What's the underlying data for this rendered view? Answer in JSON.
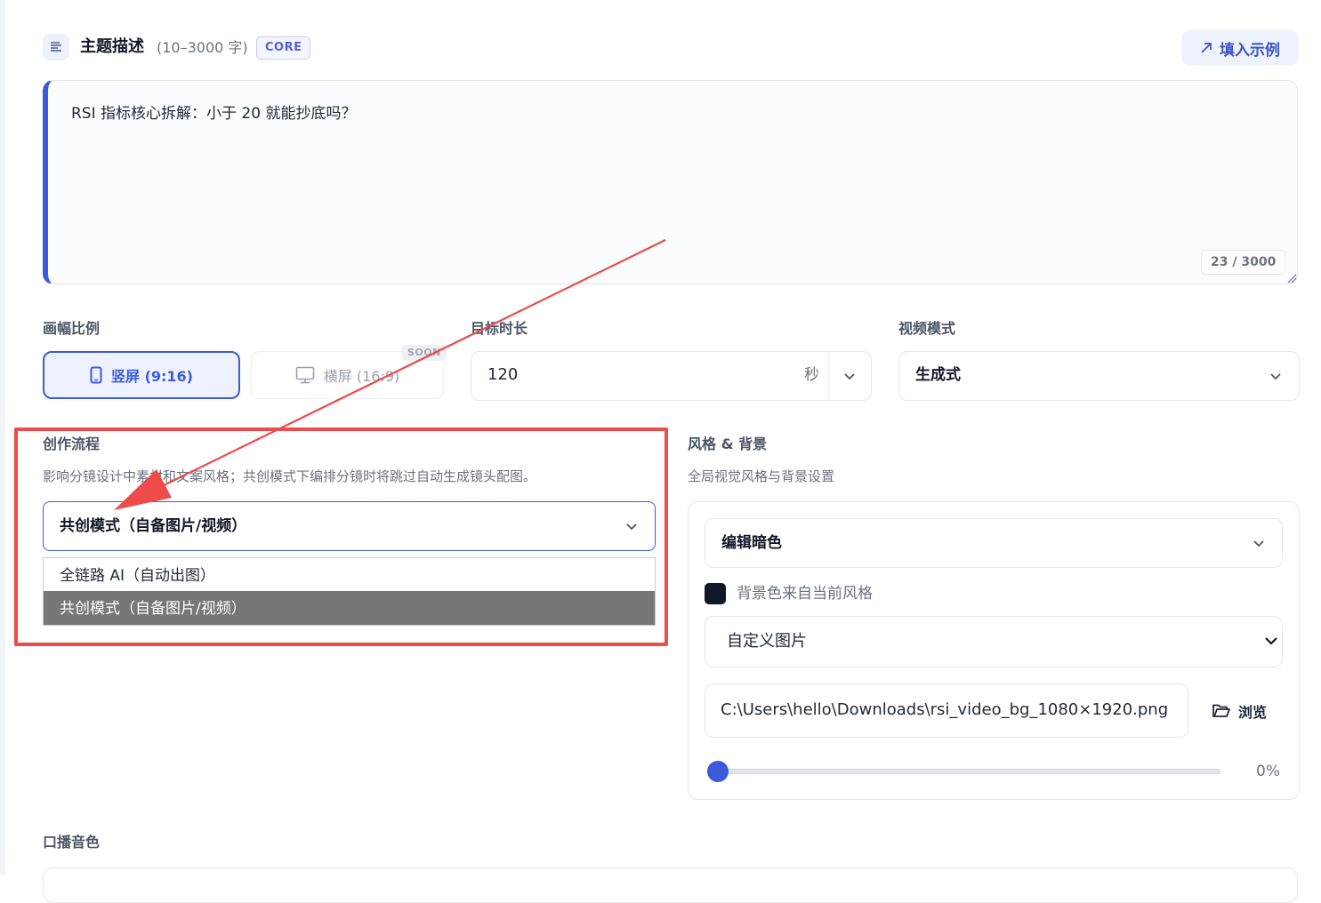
{
  "topic": {
    "title": "主题描述",
    "range": "(10–3000 字)",
    "badge": "CORE",
    "fill_example_label": "填入示例",
    "text": "RSI 指标核心拆解：小于 20 就能抄底吗？",
    "counter": "23 / 3000"
  },
  "ratio": {
    "label": "画幅比例",
    "portrait_label": "竖屏 (9:16)",
    "landscape_label": "横屏 (16:9)",
    "soon_badge": "SOON"
  },
  "duration": {
    "label": "目标时长",
    "value": "120",
    "unit": "秒"
  },
  "video_mode": {
    "label": "视频模式",
    "value": "生成式"
  },
  "workflow": {
    "label": "创作流程",
    "description": "影响分镜设计中素材和文案风格；共创模式下编排分镜时将跳过自动生成镜头配图。",
    "selected": "共创模式（自备图片/视频）",
    "options": [
      "全链路 AI（自动出图）",
      "共创模式（自备图片/视频）"
    ]
  },
  "style_bg": {
    "label": "风格 & 背景",
    "description": "全局视觉风格与背景设置",
    "theme": "编辑暗色",
    "swatch_color": "#101827",
    "swatch_label": "背景色来自当前风格",
    "bg_type": "自定义图片",
    "bg_path": "C:\\Users\\hello\\Downloads\\rsi_video_bg_1080×1920.png",
    "browse_label": "浏览",
    "opacity_percent": 0,
    "opacity_text": "0%"
  },
  "voice": {
    "label": "口播音色"
  },
  "colors": {
    "accent": "#3b5bdb",
    "annotation_red": "#ee4b4b",
    "highlight_option": "#777777"
  }
}
